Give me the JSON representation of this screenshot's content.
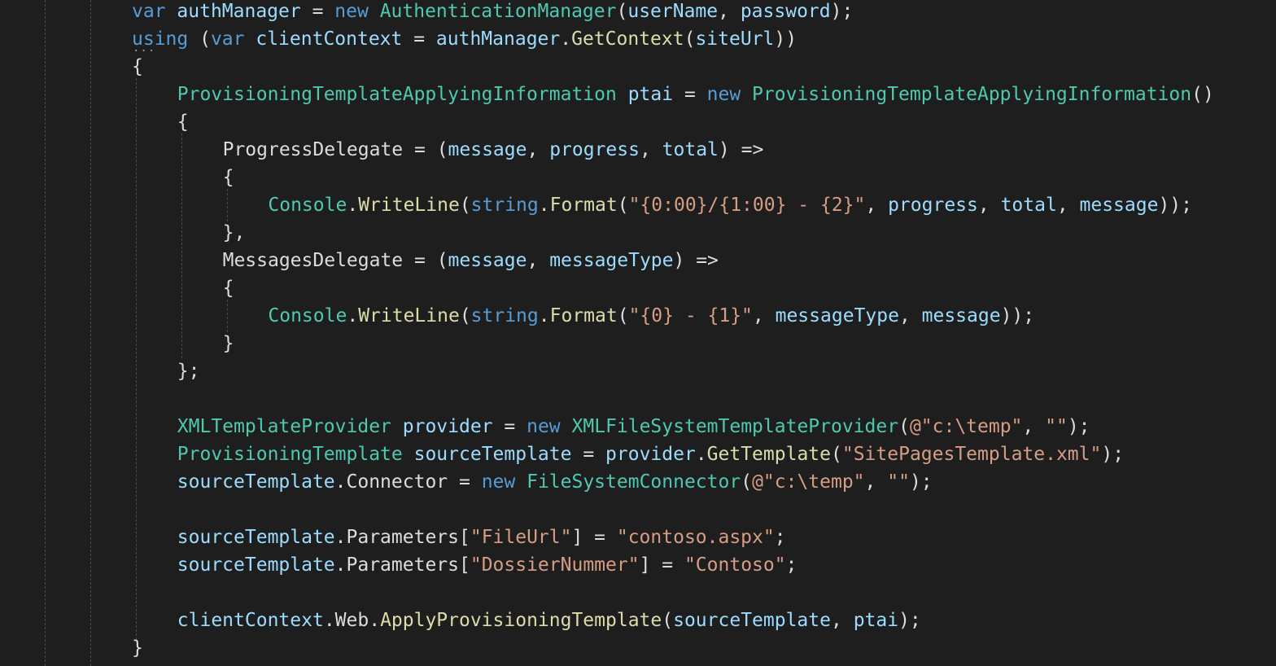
{
  "colors": {
    "background": "#1e1e1e",
    "keyword": "#569cd6",
    "type": "#4ec9b0",
    "variable": "#9cdcfe",
    "method": "#dcdcaa",
    "string": "#d69d85",
    "plain": "#dcdcdc",
    "guide": "#4a4a4a"
  },
  "code": {
    "lines": [
      {
        "indent": 6,
        "tokens": [
          [
            "kw",
            "var"
          ],
          [
            "p",
            " "
          ],
          [
            "v",
            "authManager"
          ],
          [
            "p",
            " = "
          ],
          [
            "kw",
            "new"
          ],
          [
            "p",
            " "
          ],
          [
            "t",
            "AuthenticationManager"
          ],
          [
            "p",
            "("
          ],
          [
            "v",
            "userName"
          ],
          [
            "p",
            ", "
          ],
          [
            "v",
            "password"
          ],
          [
            "p",
            ");"
          ]
        ]
      },
      {
        "indent": 6,
        "tokens": [
          [
            "kw",
            "using"
          ],
          [
            "p",
            " ("
          ],
          [
            "kw",
            "var"
          ],
          [
            "p",
            " "
          ],
          [
            "v",
            "clientContext"
          ],
          [
            "p",
            " = "
          ],
          [
            "v",
            "authManager"
          ],
          [
            "p",
            "."
          ],
          [
            "f",
            "GetContext"
          ],
          [
            "p",
            "("
          ],
          [
            "v",
            "siteUrl"
          ],
          [
            "p",
            "))"
          ]
        ]
      },
      {
        "indent": 6,
        "tokens": [
          [
            "p",
            "{"
          ]
        ]
      },
      {
        "indent": 8,
        "tokens": [
          [
            "t",
            "ProvisioningTemplateApplyingInformation"
          ],
          [
            "p",
            " "
          ],
          [
            "v",
            "ptai"
          ],
          [
            "p",
            " = "
          ],
          [
            "kw",
            "new"
          ],
          [
            "p",
            " "
          ],
          [
            "t",
            "ProvisioningTemplateApplyingInformation"
          ],
          [
            "p",
            "()"
          ]
        ]
      },
      {
        "indent": 8,
        "tokens": [
          [
            "p",
            "{"
          ]
        ]
      },
      {
        "indent": 10,
        "tokens": [
          [
            "p",
            "ProgressDelegate = ("
          ],
          [
            "v",
            "message"
          ],
          [
            "p",
            ", "
          ],
          [
            "v",
            "progress"
          ],
          [
            "p",
            ", "
          ],
          [
            "v",
            "total"
          ],
          [
            "p",
            ") =>"
          ]
        ]
      },
      {
        "indent": 10,
        "tokens": [
          [
            "p",
            "{"
          ]
        ]
      },
      {
        "indent": 12,
        "tokens": [
          [
            "t",
            "Console"
          ],
          [
            "p",
            "."
          ],
          [
            "f",
            "WriteLine"
          ],
          [
            "p",
            "("
          ],
          [
            "kw",
            "string"
          ],
          [
            "p",
            "."
          ],
          [
            "f",
            "Format"
          ],
          [
            "p",
            "("
          ],
          [
            "s",
            "\"{0:00}/{1:00} - {2}\""
          ],
          [
            "p",
            ", "
          ],
          [
            "v",
            "progress"
          ],
          [
            "p",
            ", "
          ],
          [
            "v",
            "total"
          ],
          [
            "p",
            ", "
          ],
          [
            "v",
            "message"
          ],
          [
            "p",
            "));"
          ]
        ]
      },
      {
        "indent": 10,
        "tokens": [
          [
            "p",
            "},"
          ]
        ]
      },
      {
        "indent": 10,
        "tokens": [
          [
            "p",
            "MessagesDelegate = ("
          ],
          [
            "v",
            "message"
          ],
          [
            "p",
            ", "
          ],
          [
            "v",
            "messageType"
          ],
          [
            "p",
            ") =>"
          ]
        ]
      },
      {
        "indent": 10,
        "tokens": [
          [
            "p",
            "{"
          ]
        ]
      },
      {
        "indent": 12,
        "tokens": [
          [
            "t",
            "Console"
          ],
          [
            "p",
            "."
          ],
          [
            "f",
            "WriteLine"
          ],
          [
            "p",
            "("
          ],
          [
            "kw",
            "string"
          ],
          [
            "p",
            "."
          ],
          [
            "f",
            "Format"
          ],
          [
            "p",
            "("
          ],
          [
            "s",
            "\"{0} - {1}\""
          ],
          [
            "p",
            ", "
          ],
          [
            "v",
            "messageType"
          ],
          [
            "p",
            ", "
          ],
          [
            "v",
            "message"
          ],
          [
            "p",
            "));"
          ]
        ]
      },
      {
        "indent": 10,
        "tokens": [
          [
            "p",
            "}"
          ]
        ]
      },
      {
        "indent": 8,
        "tokens": [
          [
            "p",
            "};"
          ]
        ]
      },
      {
        "indent": 0,
        "tokens": []
      },
      {
        "indent": 8,
        "tokens": [
          [
            "t",
            "XMLTemplateProvider"
          ],
          [
            "p",
            " "
          ],
          [
            "v",
            "provider"
          ],
          [
            "p",
            " = "
          ],
          [
            "kw",
            "new"
          ],
          [
            "p",
            " "
          ],
          [
            "t",
            "XMLFileSystemTemplateProvider"
          ],
          [
            "p",
            "("
          ],
          [
            "s",
            "@\"c:\\temp\""
          ],
          [
            "p",
            ", "
          ],
          [
            "s",
            "\"\""
          ],
          [
            "p",
            ");"
          ]
        ]
      },
      {
        "indent": 8,
        "tokens": [
          [
            "t",
            "ProvisioningTemplate"
          ],
          [
            "p",
            " "
          ],
          [
            "v",
            "sourceTemplate"
          ],
          [
            "p",
            " = "
          ],
          [
            "v",
            "provider"
          ],
          [
            "p",
            "."
          ],
          [
            "f",
            "GetTemplate"
          ],
          [
            "p",
            "("
          ],
          [
            "s",
            "\"SitePagesTemplate.xml\""
          ],
          [
            "p",
            ");"
          ]
        ]
      },
      {
        "indent": 8,
        "tokens": [
          [
            "v",
            "sourceTemplate"
          ],
          [
            "p",
            ".Connector = "
          ],
          [
            "kw",
            "new"
          ],
          [
            "p",
            " "
          ],
          [
            "t",
            "FileSystemConnector"
          ],
          [
            "p",
            "("
          ],
          [
            "s",
            "@\"c:\\temp\""
          ],
          [
            "p",
            ", "
          ],
          [
            "s",
            "\"\""
          ],
          [
            "p",
            ");"
          ]
        ]
      },
      {
        "indent": 0,
        "tokens": []
      },
      {
        "indent": 8,
        "tokens": [
          [
            "v",
            "sourceTemplate"
          ],
          [
            "p",
            ".Parameters["
          ],
          [
            "s",
            "\"FileUrl\""
          ],
          [
            "p",
            "] = "
          ],
          [
            "s",
            "\"contoso.aspx\""
          ],
          [
            "p",
            ";"
          ]
        ]
      },
      {
        "indent": 8,
        "tokens": [
          [
            "v",
            "sourceTemplate"
          ],
          [
            "p",
            ".Parameters["
          ],
          [
            "s",
            "\"DossierNummer\""
          ],
          [
            "p",
            "] = "
          ],
          [
            "s",
            "\"Contoso\""
          ],
          [
            "p",
            ";"
          ]
        ]
      },
      {
        "indent": 0,
        "tokens": []
      },
      {
        "indent": 8,
        "tokens": [
          [
            "v",
            "clientContext"
          ],
          [
            "p",
            ".Web."
          ],
          [
            "f",
            "ApplyProvisioningTemplate"
          ],
          [
            "p",
            "("
          ],
          [
            "v",
            "sourceTemplate"
          ],
          [
            "p",
            ", "
          ],
          [
            "v",
            "ptai"
          ],
          [
            "p",
            ");"
          ]
        ]
      },
      {
        "indent": 6,
        "tokens": [
          [
            "p",
            "}"
          ]
        ]
      }
    ]
  }
}
